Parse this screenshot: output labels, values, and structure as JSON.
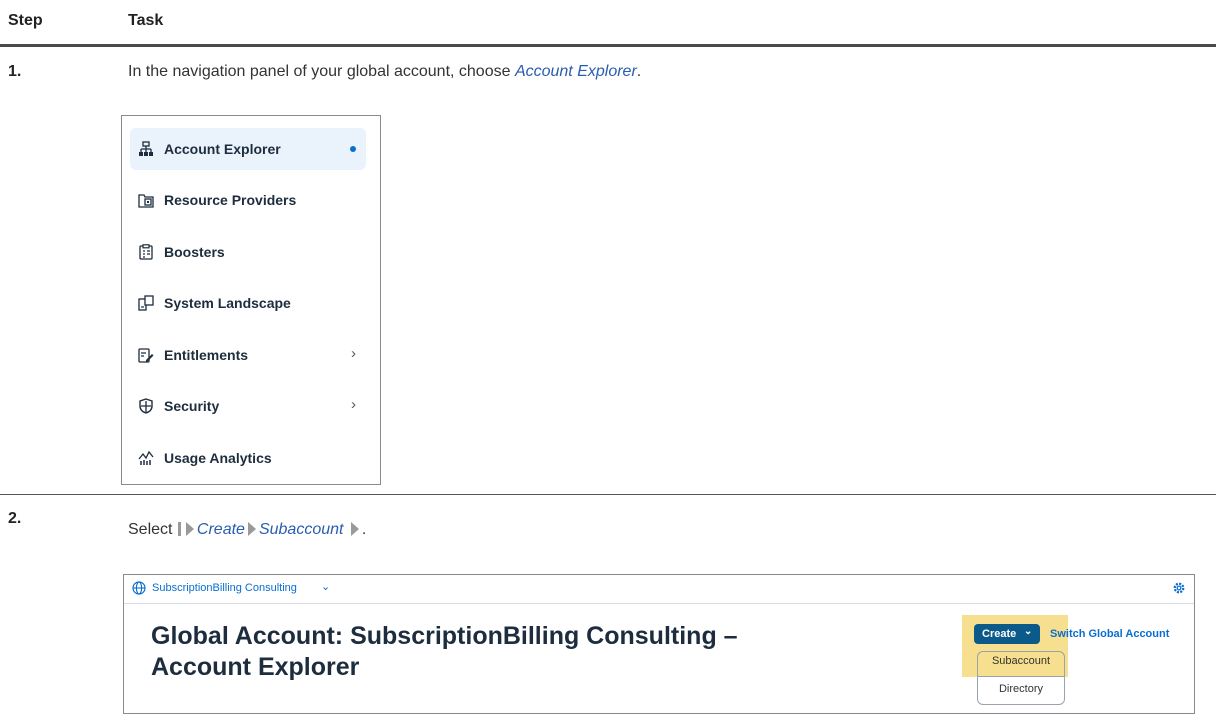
{
  "table": {
    "col_step": "Step",
    "col_task": "Task"
  },
  "step1": {
    "number": "1.",
    "text_before": "In the navigation panel of your global account, choose ",
    "link": "Account Explorer",
    "text_after": ".",
    "nav": [
      {
        "label": "Account Explorer",
        "icon": "hierarchy-icon",
        "selected": true
      },
      {
        "label": "Resource Providers",
        "icon": "resource-icon"
      },
      {
        "label": "Boosters",
        "icon": "clipboard-icon"
      },
      {
        "label": "System Landscape",
        "icon": "landscape-icon"
      },
      {
        "label": "Entitlements",
        "icon": "edit-clipboard-icon",
        "chevron": "›"
      },
      {
        "label": "Security",
        "icon": "shield-icon",
        "chevron": "›"
      },
      {
        "label": "Usage Analytics",
        "icon": "analytics-icon"
      }
    ]
  },
  "step2": {
    "number": "2.",
    "text_before": "Select ",
    "path1": "Create",
    "path2": "Subaccount",
    "text_after": ".",
    "shot": {
      "breadcrumb": "SubscriptionBilling Consulting",
      "breadcrumb_chevron": "⌄",
      "title_line1": "Global Account: SubscriptionBilling Consulting –",
      "title_line2": "Account Explorer",
      "create_label": "Create",
      "create_chevron": "⌄",
      "switch_label": "Switch Global Account",
      "menu": [
        "Subaccount",
        "Directory"
      ],
      "highlight_color": "#f4d97a"
    }
  }
}
